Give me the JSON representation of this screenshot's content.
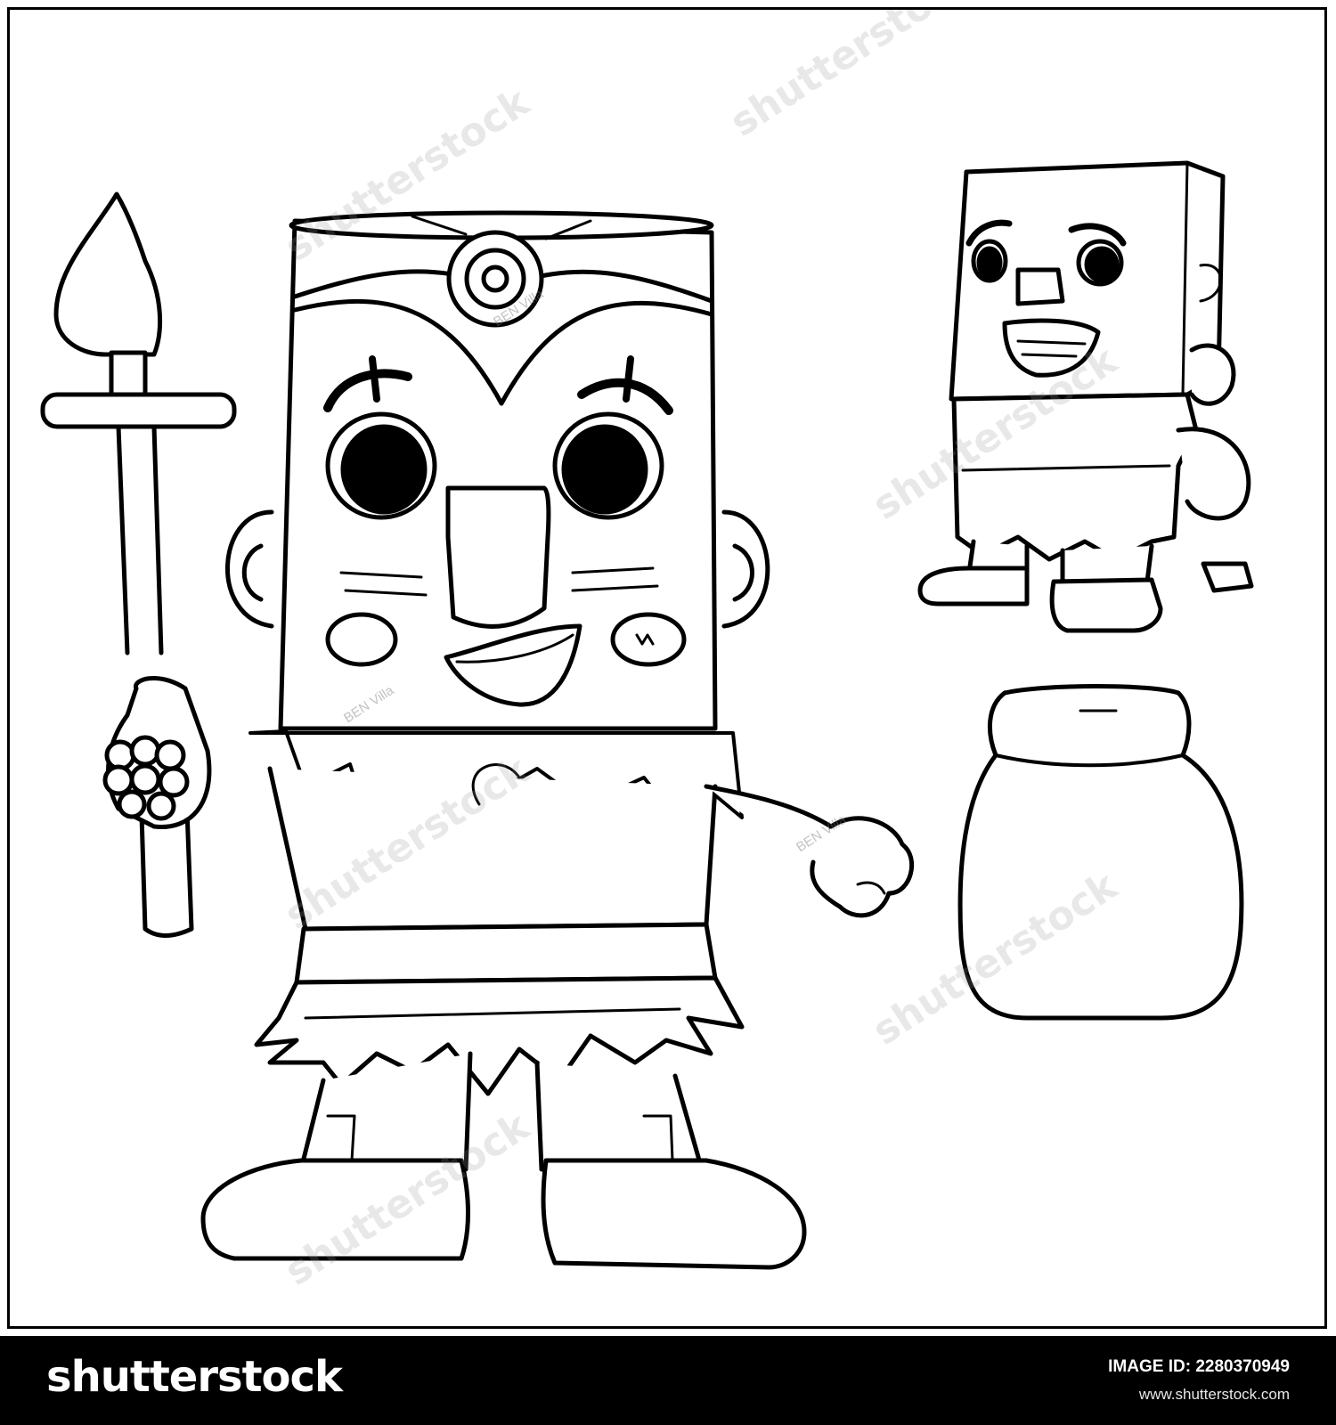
{
  "footer": {
    "brand": "shutterstock",
    "image_id": "IMAGE ID: 2280370949",
    "url": "www.shutterstock.com"
  },
  "watermarks": {
    "main": "shutterstock",
    "artist": "BEN Villa"
  },
  "colors": {
    "line": "#000000",
    "paper": "#ffffff",
    "footer_bg": "#000000"
  }
}
